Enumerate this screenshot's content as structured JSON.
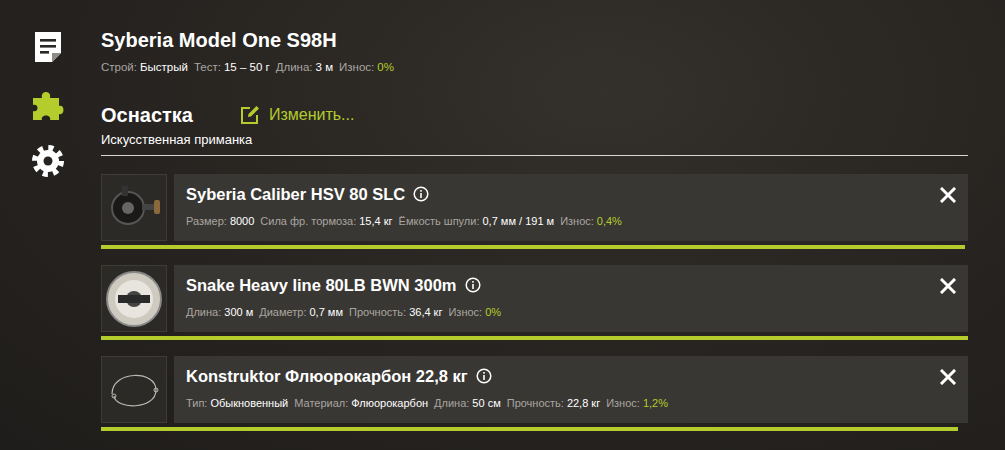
{
  "sidebar": {
    "items": [
      {
        "kind": "notes",
        "selected": false
      },
      {
        "kind": "tackle",
        "selected": true
      },
      {
        "kind": "settings",
        "selected": false
      }
    ]
  },
  "rod": {
    "title": "Syberia Model One S98H",
    "specs": [
      {
        "label": "Строй:",
        "value": "Быстрый",
        "kind": "text"
      },
      {
        "label": "Тест:",
        "value": "15 – 50 г",
        "kind": "text"
      },
      {
        "label": "Длина:",
        "value": "3 м",
        "kind": "text"
      },
      {
        "label": "Износ:",
        "value": "0%",
        "kind": "wear"
      }
    ]
  },
  "section": {
    "title": "Оснастка",
    "edit_label": "Изменить...",
    "subtitle": "Искусственная приманка"
  },
  "items": [
    {
      "kind": "reel",
      "title": "Syberia Caliber HSV 80 SLC",
      "level": 0.996,
      "specs": [
        {
          "label": "Размер:",
          "value": "8000",
          "kind": "text"
        },
        {
          "label": "Сила фр. тормоза:",
          "value": "15,4 кг",
          "kind": "text"
        },
        {
          "label": "Ёмкость шпули:",
          "value": "0,7 мм / 191 м",
          "kind": "text"
        },
        {
          "label": "Износ:",
          "value": "0,4%",
          "kind": "wear"
        }
      ]
    },
    {
      "kind": "line",
      "title": "Snake Heavy line 80LB BWN 300m",
      "level": 1,
      "specs": [
        {
          "label": "Длина:",
          "value": "300 м",
          "kind": "text"
        },
        {
          "label": "Диаметр:",
          "value": "0,7 мм",
          "kind": "text"
        },
        {
          "label": "Прочность:",
          "value": "36,4 кг",
          "kind": "text"
        },
        {
          "label": "Износ:",
          "value": "0%",
          "kind": "wear"
        }
      ]
    },
    {
      "kind": "leader",
      "title": "Konstruktor Флюорокарбон 22,8 кг",
      "level": 0.988,
      "specs": [
        {
          "label": "Тип:",
          "value": "Обыкновенный",
          "kind": "text"
        },
        {
          "label": "Материал:",
          "value": "Флюорокарбон",
          "kind": "text"
        },
        {
          "label": "Длина:",
          "value": "50 см",
          "kind": "text"
        },
        {
          "label": "Прочность:",
          "value": "22,8 кг",
          "kind": "text"
        },
        {
          "label": "Износ:",
          "value": "1,2%",
          "kind": "wear"
        }
      ]
    }
  ]
}
